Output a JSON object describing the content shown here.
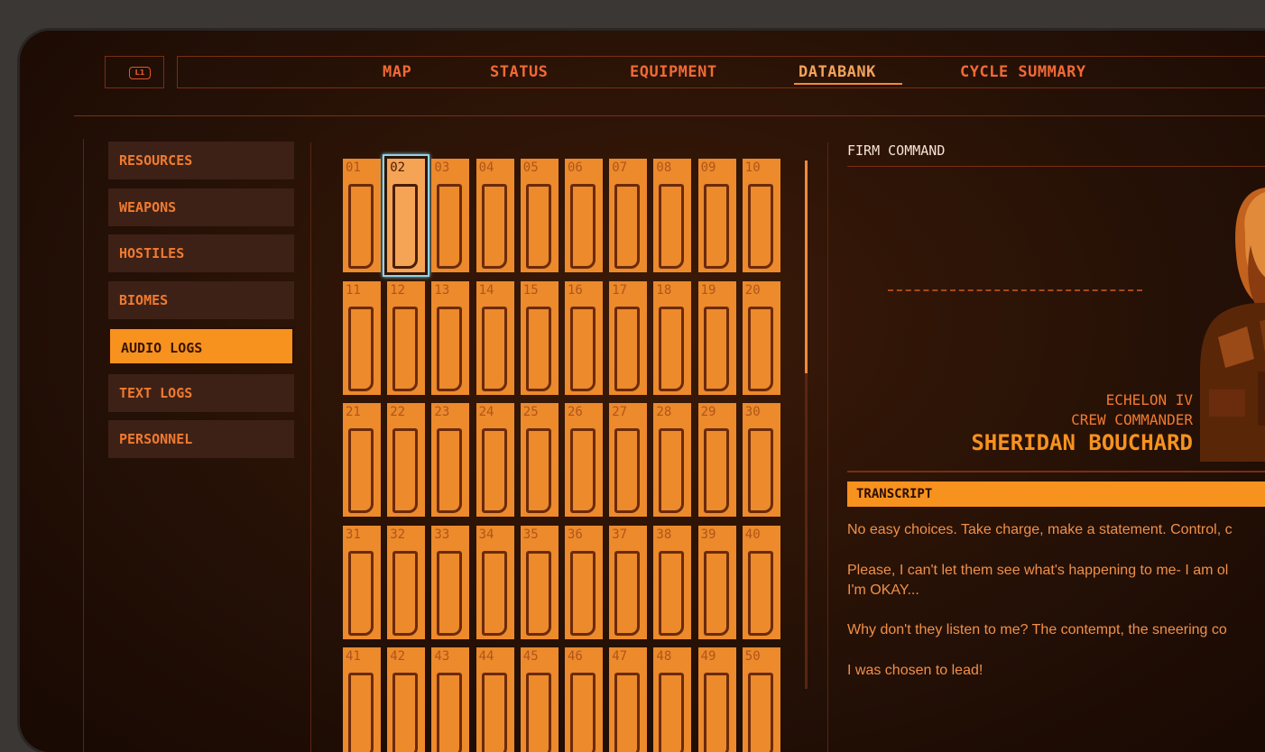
{
  "nav": {
    "badge": "L1",
    "tabs": [
      {
        "label": "MAP",
        "active": false
      },
      {
        "label": "STATUS",
        "active": false
      },
      {
        "label": "EQUIPMENT",
        "active": false
      },
      {
        "label": "DATABANK",
        "active": true
      },
      {
        "label": "CYCLE SUMMARY",
        "active": false
      }
    ]
  },
  "sidebar": {
    "items": [
      {
        "label": "RESOURCES",
        "active": false
      },
      {
        "label": "WEAPONS",
        "active": false
      },
      {
        "label": "HOSTILES",
        "active": false
      },
      {
        "label": "BIOMES",
        "active": false
      },
      {
        "label": "AUDIO LOGS",
        "active": true
      },
      {
        "label": "TEXT LOGS",
        "active": false
      },
      {
        "label": "PERSONNEL",
        "active": false
      }
    ]
  },
  "logs": {
    "selected": "02",
    "items": [
      "01",
      "02",
      "03",
      "04",
      "05",
      "06",
      "07",
      "08",
      "09",
      "10",
      "11",
      "12",
      "13",
      "14",
      "15",
      "16",
      "17",
      "18",
      "19",
      "20",
      "21",
      "22",
      "23",
      "24",
      "25",
      "26",
      "27",
      "28",
      "29",
      "30",
      "31",
      "32",
      "33",
      "34",
      "35",
      "36",
      "37",
      "38",
      "39",
      "40",
      "41",
      "42",
      "43",
      "44",
      "45",
      "46",
      "47",
      "48",
      "49",
      "50"
    ]
  },
  "detail": {
    "title": "FIRM COMMAND",
    "ship": "ECHELON IV",
    "role": "CREW COMMANDER",
    "name": "SHERIDAN BOUCHARD",
    "transcript_label": "TRANSCRIPT",
    "transcript": [
      "No easy choices. Take charge, make a statement. Control, c",
      "Please, I can't let them see what's happening to me- I am ol",
      "I'm OKAY...",
      "Why don't they listen to me? The contempt, the sneering co",
      "I was chosen to lead!"
    ]
  },
  "colors": {
    "accent": "#f7921e",
    "accent_text": "#f07a30",
    "selection": "#8fd4e6",
    "background": "#241006"
  }
}
